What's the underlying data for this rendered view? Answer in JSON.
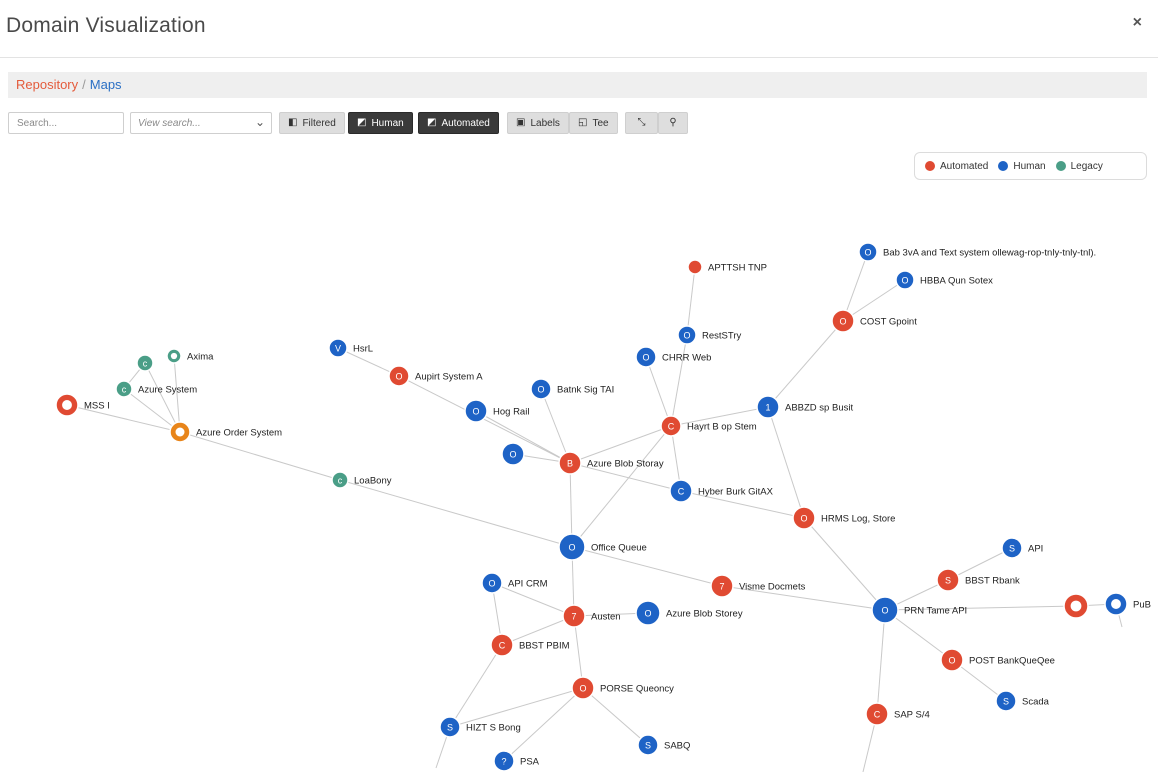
{
  "header": {
    "title": "Domain Visualization",
    "close_label": "×"
  },
  "breadcrumb": {
    "first": "Repository",
    "sep": "/",
    "last": "Maps"
  },
  "toolbar": {
    "search_placeholder": "Search...",
    "view_search_placeholder": "View search...",
    "filtered_label": "Filtered",
    "human_label": "Human",
    "automated_label": "Automated",
    "labels_label": "Labels",
    "tree_label": "Tee"
  },
  "legend": [
    {
      "label": "Automated",
      "color": "#e04a32"
    },
    {
      "label": "Human",
      "color": "#1e63c6"
    },
    {
      "label": "Legacy",
      "color": "#4a9e87"
    }
  ],
  "colors": {
    "Automated": "#e04a32",
    "Human": "#1e63c6",
    "Legacy": "#4a9e87",
    "Hub": "#e8851a"
  },
  "nodes": [
    {
      "id": "mssi",
      "label": "MSS I",
      "kind": "Automated",
      "glyph": "",
      "ring": true
    },
    {
      "id": "axima",
      "label": "Axima",
      "kind": "Legacy",
      "glyph": "",
      "ring": true
    },
    {
      "id": "legacy_c",
      "label": "",
      "kind": "Legacy",
      "glyph": "c",
      "ring": false
    },
    {
      "id": "azure_system",
      "label": "Azure System",
      "kind": "Legacy",
      "glyph": "c",
      "ring": false
    },
    {
      "id": "azure_order",
      "label": "Azure Order System",
      "kind": "Hub",
      "glyph": "",
      "ring": true
    },
    {
      "id": "loabony",
      "label": "LoaBony",
      "kind": "Legacy",
      "glyph": "c",
      "ring": false
    },
    {
      "id": "hsrl",
      "label": "HsrL",
      "kind": "Human",
      "glyph": "V",
      "ring": false
    },
    {
      "id": "aupirt",
      "label": "Aupirt System A",
      "kind": "Automated",
      "glyph": "O",
      "ring": false
    },
    {
      "id": "hog_rail",
      "label": "Hog Rail",
      "kind": "Human",
      "glyph": "O",
      "ring": false
    },
    {
      "id": "batnk",
      "label": "Batnk Sig TAI",
      "kind": "Human",
      "glyph": "O",
      "ring": false
    },
    {
      "id": "blue_o",
      "label": "",
      "kind": "Human",
      "glyph": "O",
      "ring": false
    },
    {
      "id": "azure_blob_storay",
      "label": "Azure Blob Storay",
      "kind": "Automated",
      "glyph": "B",
      "ring": false
    },
    {
      "id": "apttsh",
      "label": "APTTSH TNP",
      "kind": "Automated",
      "glyph": "",
      "ring": false
    },
    {
      "id": "restry",
      "label": "RestSTry",
      "kind": "Human",
      "glyph": "O",
      "ring": false
    },
    {
      "id": "chrr_web",
      "label": "CHRR Web",
      "kind": "Human",
      "glyph": "O",
      "ring": false
    },
    {
      "id": "hayrt",
      "label": "Hayrt B op Stem",
      "kind": "Automated",
      "glyph": "C",
      "ring": false
    },
    {
      "id": "abbzd",
      "label": "ABBZD sp Busit",
      "kind": "Human",
      "glyph": "1",
      "ring": false
    },
    {
      "id": "cost_gpoint",
      "label": "COST Gpoint",
      "kind": "Automated",
      "glyph": "O",
      "ring": false
    },
    {
      "id": "babvx",
      "label": "Bab 3vA and Text system ollewag-rop-tnly-tnly-tnl).",
      "kind": "Human",
      "glyph": "O",
      "ring": false
    },
    {
      "id": "hbba",
      "label": "HBBA Qun Sotex",
      "kind": "Human",
      "glyph": "O",
      "ring": false
    },
    {
      "id": "hyber",
      "label": "Hyber Burk GitAX",
      "kind": "Human",
      "glyph": "C",
      "ring": false
    },
    {
      "id": "hrms",
      "label": "HRMS Log, Store",
      "kind": "Automated",
      "glyph": "O",
      "ring": false
    },
    {
      "id": "office_queue",
      "label": "Office Queue",
      "kind": "Human",
      "glyph": "O",
      "ring": false
    },
    {
      "id": "api_crm",
      "label": "API CRM",
      "kind": "Human",
      "glyph": "O",
      "ring": false
    },
    {
      "id": "austen",
      "label": "Austen",
      "kind": "Automated",
      "glyph": "7",
      "ring": false
    },
    {
      "id": "visme",
      "label": "Visme Docmets",
      "kind": "Automated",
      "glyph": "7",
      "ring": false
    },
    {
      "id": "azure_blob_storey",
      "label": "Azure Blob Storey",
      "kind": "Human",
      "glyph": "O",
      "ring": false
    },
    {
      "id": "bbst_pbim",
      "label": "BBST PBIM",
      "kind": "Automated",
      "glyph": "C",
      "ring": false
    },
    {
      "id": "porse",
      "label": "PORSE Queoncy",
      "kind": "Automated",
      "glyph": "O",
      "ring": false
    },
    {
      "id": "hizt",
      "label": "HIZT S Bong",
      "kind": "Human",
      "glyph": "S",
      "ring": false
    },
    {
      "id": "sabq",
      "label": "SABQ",
      "kind": "Human",
      "glyph": "S",
      "ring": false
    },
    {
      "id": "psa",
      "label": "PSA",
      "kind": "Human",
      "glyph": "?",
      "ring": false
    },
    {
      "id": "prn",
      "label": "PRN Tame API",
      "kind": "Human",
      "glyph": "O",
      "ring": false
    },
    {
      "id": "api_s",
      "label": "API",
      "kind": "Human",
      "glyph": "S",
      "ring": false
    },
    {
      "id": "bbst_rbank",
      "label": "BBST Rbank",
      "kind": "Automated",
      "glyph": "S",
      "ring": false
    },
    {
      "id": "red_right",
      "label": "",
      "kind": "Automated",
      "glyph": "",
      "ring": true
    },
    {
      "id": "pub",
      "label": "PuB",
      "kind": "Human",
      "glyph": "",
      "ring": true
    },
    {
      "id": "post_bank",
      "label": "POST BankQueQee",
      "kind": "Automated",
      "glyph": "O",
      "ring": false
    },
    {
      "id": "scada",
      "label": "Scada",
      "kind": "Human",
      "glyph": "S",
      "ring": false
    },
    {
      "id": "sap",
      "label": "SAP S/4",
      "kind": "Automated",
      "glyph": "C",
      "ring": false
    }
  ]
}
